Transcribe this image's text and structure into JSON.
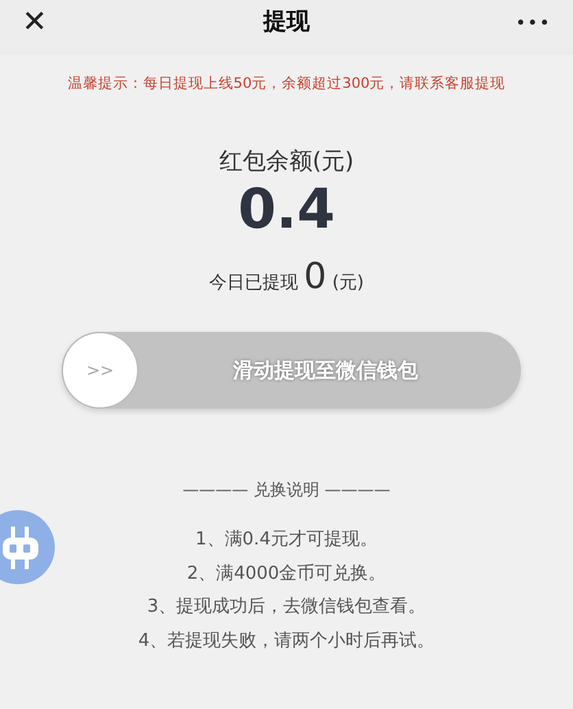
{
  "header": {
    "close": "✕",
    "title": "提现",
    "more": "•••"
  },
  "notice": "温馨提示：每日提现上线50元，余额超过300元，请联系客服提现",
  "balance": {
    "label": "红包余额(元)",
    "amount": "0.4"
  },
  "today": {
    "label": "今日已提现",
    "amount": "0",
    "unit": "(元)"
  },
  "slider": {
    "thumb": ">>",
    "text": "滑动提现至微信钱包",
    "level": 0
  },
  "rules": {
    "title": "———— 兑换说明 ————",
    "items": [
      "1、满0.4元才可提现。",
      "2、满4000金币可兑换。",
      "3、提现成功后，去微信钱包查看。",
      "4、若提现失败，请两个小时后再试。"
    ]
  }
}
